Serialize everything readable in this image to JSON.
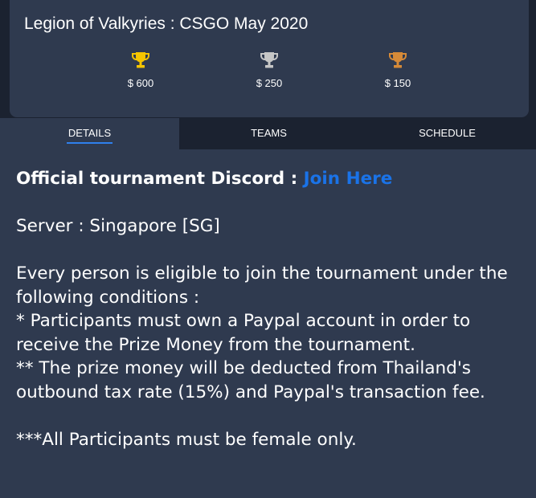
{
  "header": {
    "title": "Legion of Valkyries : CSGO May 2020",
    "prizes": [
      {
        "amount": "$ 600",
        "icon": "gold-trophy-icon",
        "color": "#f5c400"
      },
      {
        "amount": "$ 250",
        "icon": "silver-trophy-icon",
        "color": "#c6c6c6"
      },
      {
        "amount": "$ 150",
        "icon": "bronze-trophy-icon",
        "color": "#d68a38"
      }
    ]
  },
  "tabs": [
    {
      "label": "DETAILS",
      "active": true
    },
    {
      "label": "TEAMS",
      "active": false
    },
    {
      "label": "SCHEDULE",
      "active": false
    }
  ],
  "details": {
    "discord_label": "Official tournament Discord : ",
    "discord_link": "Join Here",
    "server": "Server : Singapore [SG]",
    "eligibility": "Every person is eligible to join the tournament under the following conditions :",
    "condition_1": "* Participants must own a Paypal account in order to receive the Prize Money from the tournament.",
    "condition_2": "** The prize money will be deducted from Thailand's outbound tax rate (15%) and Paypal's transaction fee.",
    "note": "***All Participants must be female only."
  },
  "colors": {
    "background": "#2f3a4f",
    "dark": "#1b2230",
    "accent": "#2f80ed",
    "link": "#1a73e8"
  }
}
